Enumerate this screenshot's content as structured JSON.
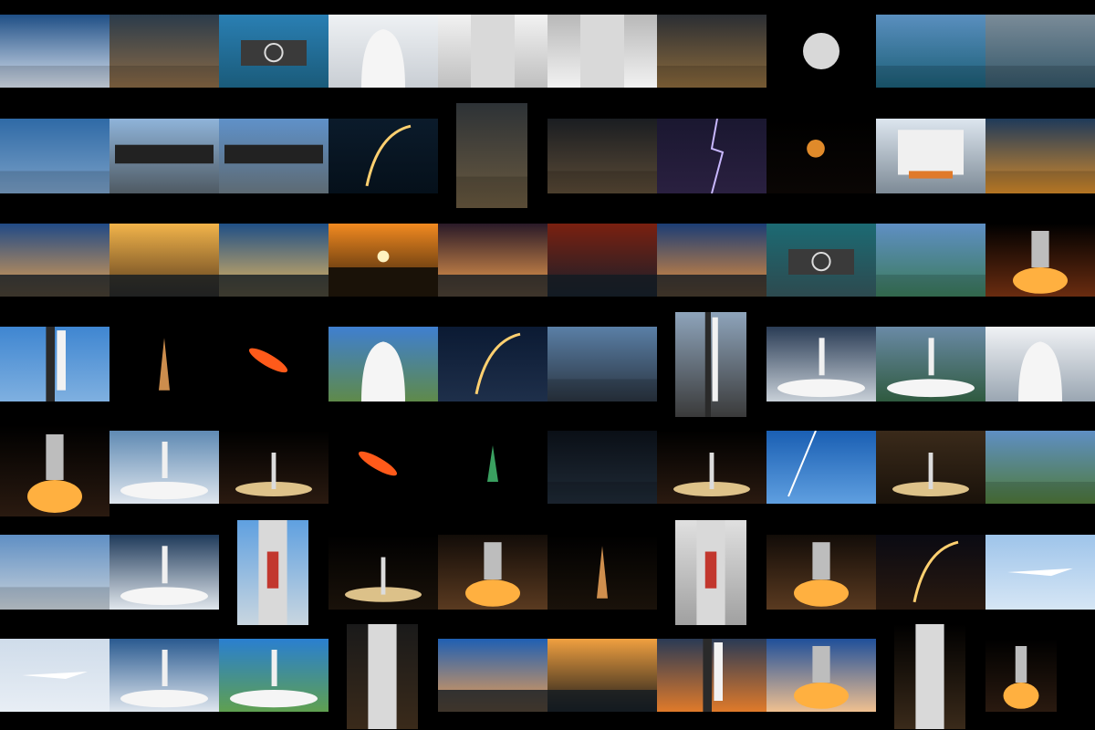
{
  "collage": {
    "rows": [
      [
        {
          "id": "r0c0",
          "bg": [
            "#1f4f86",
            "#d9e2ee"
          ],
          "subject": "cloud"
        },
        {
          "id": "r0c1",
          "bg": [
            "#2b3b4a",
            "#8a6a46"
          ],
          "subject": "landing-pad-booster"
        },
        {
          "id": "r0c2",
          "bg": [
            "#2a7fb3",
            "#1a5b7a"
          ],
          "subject": "drone-ship"
        },
        {
          "id": "r0c3",
          "bg": [
            "#eef1f4",
            "#c9ced4"
          ],
          "subject": "capsule-tower"
        },
        {
          "id": "r0c4",
          "bg": [
            "#f2f2f2",
            "#bfbfbf"
          ],
          "subject": "rocket-body"
        },
        {
          "id": "r0c5",
          "bg": [
            "#b8b8b8",
            "#f2f2f2"
          ],
          "subject": "rocket-body"
        },
        {
          "id": "r0c6",
          "bg": [
            "#2b2e33",
            "#8b6a3c"
          ],
          "subject": "hangar"
        },
        {
          "id": "r0c7",
          "bg": [
            "#000000",
            "#000000"
          ],
          "subject": "moon"
        },
        {
          "id": "r0c8",
          "bg": [
            "#5a8fbf",
            "#1c5f77"
          ],
          "subject": "ships"
        },
        {
          "id": "r0c9",
          "bg": [
            "#7a8b98",
            "#35586a"
          ],
          "subject": "port"
        }
      ],
      [
        {
          "id": "r1c0",
          "bg": [
            "#2f6aa6",
            "#7aa0c7"
          ],
          "subject": "water-salute"
        },
        {
          "id": "r1c1",
          "bg": [
            "#8fb4da",
            "#4f5a63"
          ],
          "subject": "booster-transport"
        },
        {
          "id": "r1c2",
          "bg": [
            "#5f91c9",
            "#5d6a73"
          ],
          "subject": "booster-transport"
        },
        {
          "id": "r1c3",
          "bg": [
            "#0b1b2b",
            "#05101a"
          ],
          "subject": "launch-arc"
        },
        {
          "id": "r1c4",
          "bg": [
            "#2d3236",
            "#6a5a40"
          ],
          "subject": "hangar"
        },
        {
          "id": "r1c5",
          "bg": [
            "#1a1d21",
            "#5a4a36"
          ],
          "subject": "hangar"
        },
        {
          "id": "r1c6",
          "bg": [
            "#1a1730",
            "#2a2040"
          ],
          "subject": "lightning"
        },
        {
          "id": "r1c7",
          "bg": [
            "#000000",
            "#0a0604"
          ],
          "subject": "orange-moon"
        },
        {
          "id": "r1c8",
          "bg": [
            "#dde6ef",
            "#7d8a96"
          ],
          "subject": "vab"
        },
        {
          "id": "r1c9",
          "bg": [
            "#1f3a5a",
            "#d48a2a"
          ],
          "subject": "starliner"
        }
      ],
      [
        {
          "id": "r2c0",
          "bg": [
            "#214a86",
            "#e3a050"
          ],
          "subject": "sunset"
        },
        {
          "id": "r2c1",
          "bg": [
            "#f2b44a",
            "#5a3c1e"
          ],
          "subject": "sunset"
        },
        {
          "id": "r2c2",
          "bg": [
            "#1f4f86",
            "#e6b75f"
          ],
          "subject": "sunset"
        },
        {
          "id": "r2c3",
          "bg": [
            "#f28a20",
            "#2a1a0a"
          ],
          "subject": "sun"
        },
        {
          "id": "r2c4",
          "bg": [
            "#2a1a28",
            "#f2a050"
          ],
          "subject": "sunset"
        },
        {
          "id": "r2c5",
          "bg": [
            "#7a2010",
            "#1a1f2a"
          ],
          "subject": "sunset"
        },
        {
          "id": "r2c6",
          "bg": [
            "#1c3d75",
            "#e8903a"
          ],
          "subject": "sunset"
        },
        {
          "id": "r2c7",
          "bg": [
            "#1c6a73",
            "#2d4a4f"
          ],
          "subject": "landing-pad"
        },
        {
          "id": "r2c8",
          "bg": [
            "#5f8fc4",
            "#3b7a5a"
          ],
          "subject": "harbor"
        },
        {
          "id": "r2c9",
          "bg": [
            "#000000",
            "#6a2c10"
          ],
          "subject": "engine-fire"
        }
      ],
      [
        {
          "id": "r3c0",
          "bg": [
            "#3f86d1",
            "#7fb0e0"
          ],
          "subject": "tower-rocket"
        },
        {
          "id": "r3c1",
          "bg": [
            "#000000",
            "#000000"
          ],
          "subject": "night-launch"
        },
        {
          "id": "r3c2",
          "bg": [
            "#000000",
            "#000000"
          ],
          "subject": "reentry"
        },
        {
          "id": "r3c3",
          "bg": [
            "#3f7fd0",
            "#5f8a4a"
          ],
          "subject": "dragon-capsule"
        },
        {
          "id": "r3c4",
          "bg": [
            "#0b1a33",
            "#1e2f4a"
          ],
          "subject": "launch-arc"
        },
        {
          "id": "r3c5",
          "bg": [
            "#5a7fa6",
            "#2a3440"
          ],
          "subject": "structure"
        },
        {
          "id": "r3c6",
          "bg": [
            "#8ea4bb",
            "#3a3a3a"
          ],
          "subject": "launch-tower"
        },
        {
          "id": "r3c7",
          "bg": [
            "#2a3c55",
            "#c8d0d8"
          ],
          "subject": "liftoff"
        },
        {
          "id": "r3c8",
          "bg": [
            "#6a8aa6",
            "#2f5a3f"
          ],
          "subject": "liftoff-smoke"
        },
        {
          "id": "r3c9",
          "bg": [
            "#f0f2f5",
            "#9aa6b2"
          ],
          "subject": "capsule-tower"
        }
      ],
      [
        {
          "id": "r4c0",
          "bg": [
            "#000000",
            "#2a1a10"
          ],
          "subject": "liftoff-night"
        },
        {
          "id": "r4c1",
          "bg": [
            "#5f8ab3",
            "#dfe6ee"
          ],
          "subject": "liftoff-smoke"
        },
        {
          "id": "r4c2",
          "bg": [
            "#000000",
            "#2a1a10"
          ],
          "subject": "night-launch-wide"
        },
        {
          "id": "r4c3",
          "bg": [
            "#000000",
            "#000000"
          ],
          "subject": "reentry"
        },
        {
          "id": "r4c4",
          "bg": [
            "#000000",
            "#000000"
          ],
          "subject": "green-plume"
        },
        {
          "id": "r4c5",
          "bg": [
            "#0a0f16",
            "#1f2a36"
          ],
          "subject": "pad-night"
        },
        {
          "id": "r4c6",
          "bg": [
            "#000000",
            "#2a1a10"
          ],
          "subject": "night-launch-wide"
        },
        {
          "id": "r4c7",
          "bg": [
            "#1a5fb3",
            "#5f9fe0"
          ],
          "subject": "contrail"
        },
        {
          "id": "r4c8",
          "bg": [
            "#3a2a1a",
            "#1a120a"
          ],
          "subject": "launch-glow"
        },
        {
          "id": "r4c9",
          "bg": [
            "#5f8fc4",
            "#4f7a3a"
          ],
          "subject": "coast"
        }
      ],
      [
        {
          "id": "r5c0",
          "bg": [
            "#5f8fc4",
            "#c9d2da"
          ],
          "subject": "crane-lift"
        },
        {
          "id": "r5c1",
          "bg": [
            "#1f3a5a",
            "#e0e6ec"
          ],
          "subject": "liftoff-smoke"
        },
        {
          "id": "r5c2",
          "bg": [
            "#5fa0e0",
            "#c9d6e0"
          ],
          "subject": "nasa-rocket"
        },
        {
          "id": "r5c3",
          "bg": [
            "#000000",
            "#1a120a"
          ],
          "subject": "night-launch-wide"
        },
        {
          "id": "r5c4",
          "bg": [
            "#120c08",
            "#5a3a20"
          ],
          "subject": "engine-fire"
        },
        {
          "id": "r5c5",
          "bg": [
            "#000000",
            "#1a120a"
          ],
          "subject": "night-launch"
        },
        {
          "id": "r5c6",
          "bg": [
            "#e0e0e0",
            "#a0a0a0"
          ],
          "subject": "nasa-rocket"
        },
        {
          "id": "r5c7",
          "bg": [
            "#120c08",
            "#5a3a20"
          ],
          "subject": "engine-fire"
        },
        {
          "id": "r5c8",
          "bg": [
            "#0a0a12",
            "#2a1a10"
          ],
          "subject": "launch-arc"
        },
        {
          "id": "r5c9",
          "bg": [
            "#9ec4ea",
            "#d6e6f5"
          ],
          "subject": "jets"
        }
      ],
      [
        {
          "id": "r6c0",
          "bg": [
            "#cfdcea",
            "#e8eef5"
          ],
          "subject": "jet"
        },
        {
          "id": "r6c1",
          "bg": [
            "#2a5a90",
            "#dfe6ee"
          ],
          "subject": "liftoff-smoke"
        },
        {
          "id": "r6c2",
          "bg": [
            "#2a7fd0",
            "#5fa050"
          ],
          "subject": "liftoff-smoke"
        },
        {
          "id": "r6c3",
          "bg": [
            "#1a1a1a",
            "#3a2a1a"
          ],
          "subject": "rocket-vertical"
        },
        {
          "id": "r6c4",
          "bg": [
            "#1f5fb3",
            "#f2a050"
          ],
          "subject": "dawn"
        },
        {
          "id": "r6c5",
          "bg": [
            "#f0a040",
            "#1a1a1a"
          ],
          "subject": "dawn"
        },
        {
          "id": "r6c6",
          "bg": [
            "#2a3a55",
            "#e07a2a"
          ],
          "subject": "tower-fire"
        },
        {
          "id": "r6c7",
          "bg": [
            "#1f4f9a",
            "#f0c090"
          ],
          "subject": "engine-fire"
        },
        {
          "id": "r6c8",
          "bg": [
            "#000000",
            "#3a2a1a"
          ],
          "subject": "rocket-vertical"
        },
        {
          "id": "r6c9",
          "bg": [
            "#000000",
            "#2a1a10"
          ],
          "subject": "engine-fire"
        }
      ]
    ]
  },
  "colors": {
    "background": "#000000"
  }
}
